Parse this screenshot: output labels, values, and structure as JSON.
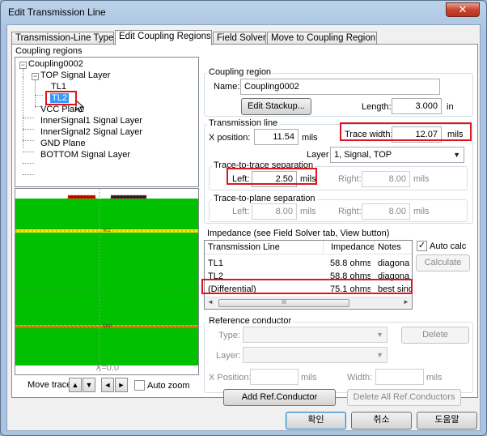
{
  "window": {
    "title": "Edit Transmission Line",
    "close": "✕"
  },
  "tabs": [
    {
      "label": "Transmission-Line Type"
    },
    {
      "label": "Edit Coupling Regions"
    },
    {
      "label": "Field Solver"
    },
    {
      "label": "Move to Coupling Region"
    }
  ],
  "coupling_regions": {
    "label": "Coupling regions",
    "tree": {
      "root": "Coupling0002",
      "top_layer": "TOP Signal Layer",
      "tl1": "TL1",
      "tl2": "TL2",
      "vcc": "VCC Plane",
      "inner1": "InnerSignal1 Signal Layer",
      "inner2": "InnerSignal2 Signal Layer",
      "gnd": "GND Plane",
      "bottom": "BOTTOM Signal Layer"
    },
    "preview_x_label": "X=0.0",
    "colors": {
      "dielectric": "#00c000",
      "plane": "#ffe800",
      "trace": "#c00000"
    }
  },
  "move_trace": {
    "label": "Move trace:",
    "auto_zoom": "Auto zoom"
  },
  "coupling_region": {
    "title": "Coupling region",
    "name_label": "Name:",
    "name_value": "Coupling0002",
    "edit_stackup": "Edit Stackup...",
    "length_label": "Length:",
    "length_value": "3.000",
    "length_unit": "in"
  },
  "transmission_line": {
    "title": "Transmission line",
    "xpos_label": "X position:",
    "xpos_value": "11.54",
    "xpos_unit": "mils",
    "trace_width_label": "Trace width:",
    "trace_width_value": "12.07",
    "trace_width_unit": "mils",
    "layer_label": "Layer",
    "layer_value": "1, Signal, TOP",
    "tt_sep_title": "Trace-to-trace separation",
    "left_label": "Left:",
    "left_value": "2.50",
    "left_unit": "mils",
    "right_label": "Right:",
    "right_value": "8.00",
    "right_unit": "mils",
    "tp_sep_title": "Trace-to-plane separation",
    "tp_left_label": "Left:",
    "tp_left_value": "8.00",
    "tp_left_unit": "mils",
    "tp_right_label": "Right:",
    "tp_right_value": "8.00",
    "tp_right_unit": "mils"
  },
  "impedance": {
    "title": "Impedance (see Field Solver tab, View button)",
    "columns": [
      "Transmission Line",
      "Impedance",
      "Notes"
    ],
    "rows": [
      [
        "TL1",
        "58.8 ohms",
        "diagona"
      ],
      [
        "TL2",
        "58.8 ohms",
        "diagona"
      ],
      [
        "(Differential)",
        "75.1 ohms",
        "best sing"
      ]
    ],
    "auto_calc": "Auto calc",
    "calculate": "Calculate",
    "scroll_left": "◄",
    "scroll_thumb": "III",
    "scroll_right": "►"
  },
  "reference_conductor": {
    "title": "Reference conductor",
    "type_label": "Type:",
    "delete": "Delete",
    "layer_label": "Layer:",
    "xpos_label": "X Position:",
    "xpos_unit": "mils",
    "width_label": "Width:",
    "width_unit": "mils",
    "add": "Add Ref.Conductor",
    "delete_all": "Delete All Ref.Conductors"
  },
  "footer": {
    "ok": "확인",
    "cancel": "취소",
    "help": "도움말"
  }
}
